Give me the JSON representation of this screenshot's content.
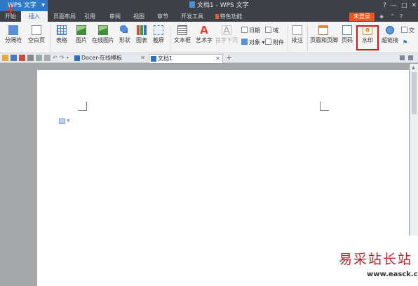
{
  "titlebar": {
    "app_label": "WPS 文字",
    "document_title": "文档1 - WPS 文字",
    "controls": [
      "?",
      "—",
      "□",
      "✕"
    ]
  },
  "menu": {
    "tabs": [
      "开始",
      "插入",
      "页面布局",
      "引用",
      "审阅",
      "视图",
      "章节",
      "开发工具",
      "特色功能"
    ],
    "active_tab": "插入",
    "login_label": "未登录"
  },
  "ribbon": {
    "page_break": "分隔符",
    "blank_page": "空白页",
    "table": "表格",
    "picture": "图片",
    "online_picture": "在线图片",
    "shapes": "形状",
    "chart": "图表",
    "screenshot": "截屏",
    "textbox": "文本框",
    "wordart": "艺术字",
    "dropcap": "首字下沉",
    "date": "日期",
    "field": "域",
    "object": "对象",
    "attachment": "附件",
    "comment": "批注",
    "header_footer": "页眉和页脚",
    "page_number": "页码",
    "watermark": "水印",
    "hyperlink": "超链接",
    "crossref": "交"
  },
  "doc_tabs": {
    "tabs": [
      {
        "label": "Docer-在线模板",
        "close": "✕"
      },
      {
        "label": "文档1",
        "close": "✕"
      }
    ],
    "add": "+"
  },
  "watermark": {
    "site_name": "易采站长站",
    "site_url": "www.easck.com"
  },
  "colors": {
    "app_button": "#2f79c7",
    "title_bar": "#3d4046",
    "login_button": "#e8571f",
    "highlight_box": "#d21a1a",
    "watermark_text": "#c0202a"
  }
}
